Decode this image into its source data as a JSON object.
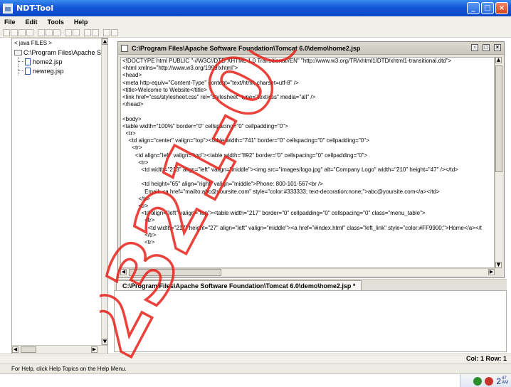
{
  "window": {
    "title": "NDT-Tool"
  },
  "menu": [
    "File",
    "Edit",
    "Tools",
    "Help"
  ],
  "tree": {
    "header": "< java FILES >",
    "root": "C:\\Program Files\\Apache Sof",
    "files": [
      "home2.jsp",
      "newreg.jsp"
    ]
  },
  "editor": {
    "title": "C:\\Program Files\\Apache Software Foundation\\Tomcat 6.0\\demo\\home2.jsp",
    "tab_label": "C:\\Program Files\\Apache Software Foundation\\Tomcat 6.0\\demo\\home2.jsp *",
    "lines": [
      "<!DOCTYPE html PUBLIC \"-//W3C//DTD XHTML 1.0 Transitional//EN\" \"http://www.w3.org/TR/xhtml1/DTD/xhtml1-transitional.dtd\">",
      "<html xmlns=\"http://www.w3.org/1999/xhtml\">",
      "<head>",
      "<meta http-equiv=\"Content-Type\" content=\"text/html; charset=utf-8\" />",
      "<title>Welcome to Website</title>",
      "<link href=\"css/stylesheet.css\" rel=\"stylesheet\" type=\"text/css\" media=\"all\" />",
      "</head>",
      "",
      "<body>",
      "<table width=\"100%\" border=\"0\" cellspacing=\"0\" cellpadding=\"0\">",
      "  <tr>",
      "    <td align=\"center\" valign=\"top\"><table width=\"741\" border=\"0\" cellspacing=\"0\" cellpadding=\"0\">",
      "      <tr>",
      "        <td align=\"left\" valign=\"top\"><table width=\"892\" border=\"0\" cellspacing=\"0\" cellpadding=\"0\">",
      "          <tr>",
      "            <td width=\"213\" align=\"left\" valign=\"middle\"><img src=\"images/logo.jpg\" alt=\"Company Logo\" width=\"210\" height=\"47\" /></td>",
      "",
      "            <td height=\"65\" align=\"right\" valign=\"middle\">Phone: 800-101-567<br />",
      "              Email: <a href=\"mailto:abc@yoursite.com\" style=\"color:#333333; text-decoration:none;\">abc@yoursite.com</a></td>",
      "          </tr>",
      "          <tr>",
      "            <td align=\"left\" valign=\"top\"><table width=\"217\" border=\"0\" cellpadding=\"0\" cellspacing=\"0\" class=\"menu_table\">",
      "              <tr>",
      "                <td width=\"217\" height=\"27\" align=\"left\" valign=\"middle\"><a href=\"#index.html\" class=\"left_link\" style=\"color:#FF9900;\">Home</a></t",
      "              </tr>",
      "              <tr>"
    ]
  },
  "status": {
    "position": "Col: 1 Row: 1"
  },
  "helpline": "For Help, click Help Topics on the Help Menu.",
  "taskbar": {
    "clock_hour": "2",
    "clock_min": "47",
    "clock_ampm": "AM"
  },
  "watermark": {
    "text": "2321-0653"
  },
  "colors": {
    "titlebar": "#1257d8",
    "chrome": "#f0efe9",
    "watermark": "#e8221a"
  }
}
